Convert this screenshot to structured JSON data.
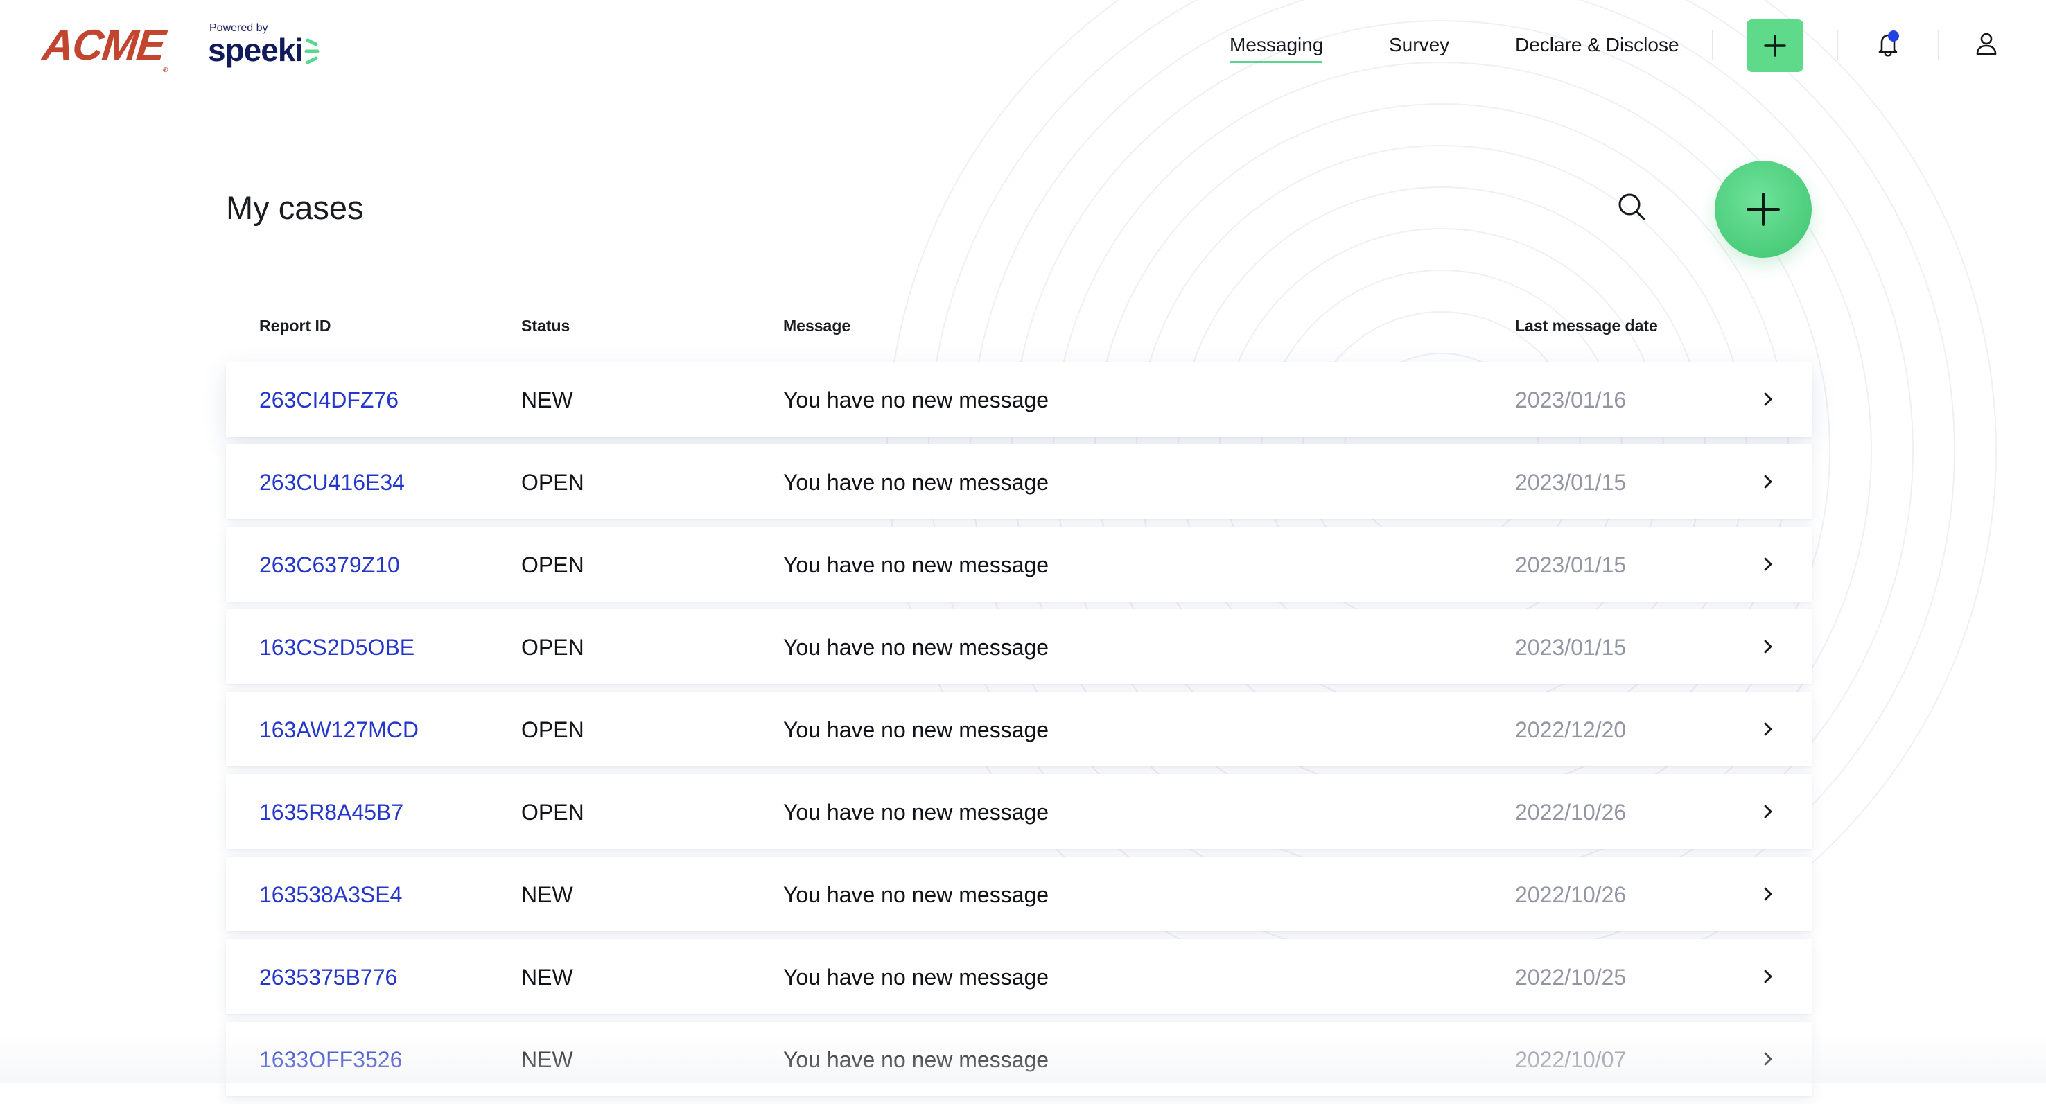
{
  "brand": {
    "logo_text": "ACME",
    "logo_mark": "®",
    "powered_by": "Powered by",
    "speeki": "speeki"
  },
  "nav": {
    "items": [
      {
        "label": "Messaging",
        "active": true
      },
      {
        "label": "Survey",
        "active": false
      },
      {
        "label": "Declare & Disclose",
        "active": false
      }
    ],
    "add_icon": "plus-icon",
    "notification_icon": "bell-icon",
    "profile_icon": "user-icon"
  },
  "page": {
    "title": "My cases",
    "search_icon": "search-icon",
    "new_case_icon": "plus-icon"
  },
  "table": {
    "headers": {
      "report_id": "Report ID",
      "status": "Status",
      "message": "Message",
      "last_message_date": "Last message date"
    },
    "rows": [
      {
        "id": "263CI4DFZ76",
        "status": "NEW",
        "message": "You have no new message",
        "date": "2023/01/16"
      },
      {
        "id": "263CU416E34",
        "status": "OPEN",
        "message": "You have no new message",
        "date": "2023/01/15"
      },
      {
        "id": "263C6379Z10",
        "status": "OPEN",
        "message": "You have no new message",
        "date": "2023/01/15"
      },
      {
        "id": "163CS2D5OBE",
        "status": "OPEN",
        "message": "You have no new message",
        "date": "2023/01/15"
      },
      {
        "id": "163AW127MCD",
        "status": "OPEN",
        "message": "You have no new message",
        "date": "2022/12/20"
      },
      {
        "id": "1635R8A45B7",
        "status": "OPEN",
        "message": "You have no new message",
        "date": "2022/10/26"
      },
      {
        "id": "163538A3SE4",
        "status": "NEW",
        "message": "You have no new message",
        "date": "2022/10/26"
      },
      {
        "id": "2635375B776",
        "status": "NEW",
        "message": "You have no new message",
        "date": "2022/10/25"
      },
      {
        "id": "1633OFF3526",
        "status": "NEW",
        "message": "You have no new message",
        "date": "2022/10/07"
      }
    ]
  },
  "colors": {
    "accent_green": "#5fd98a",
    "link_blue": "#2437c8",
    "acme_red": "#c2452f",
    "notification_dot": "#1f43e0",
    "date_gray": "#9296a2"
  }
}
